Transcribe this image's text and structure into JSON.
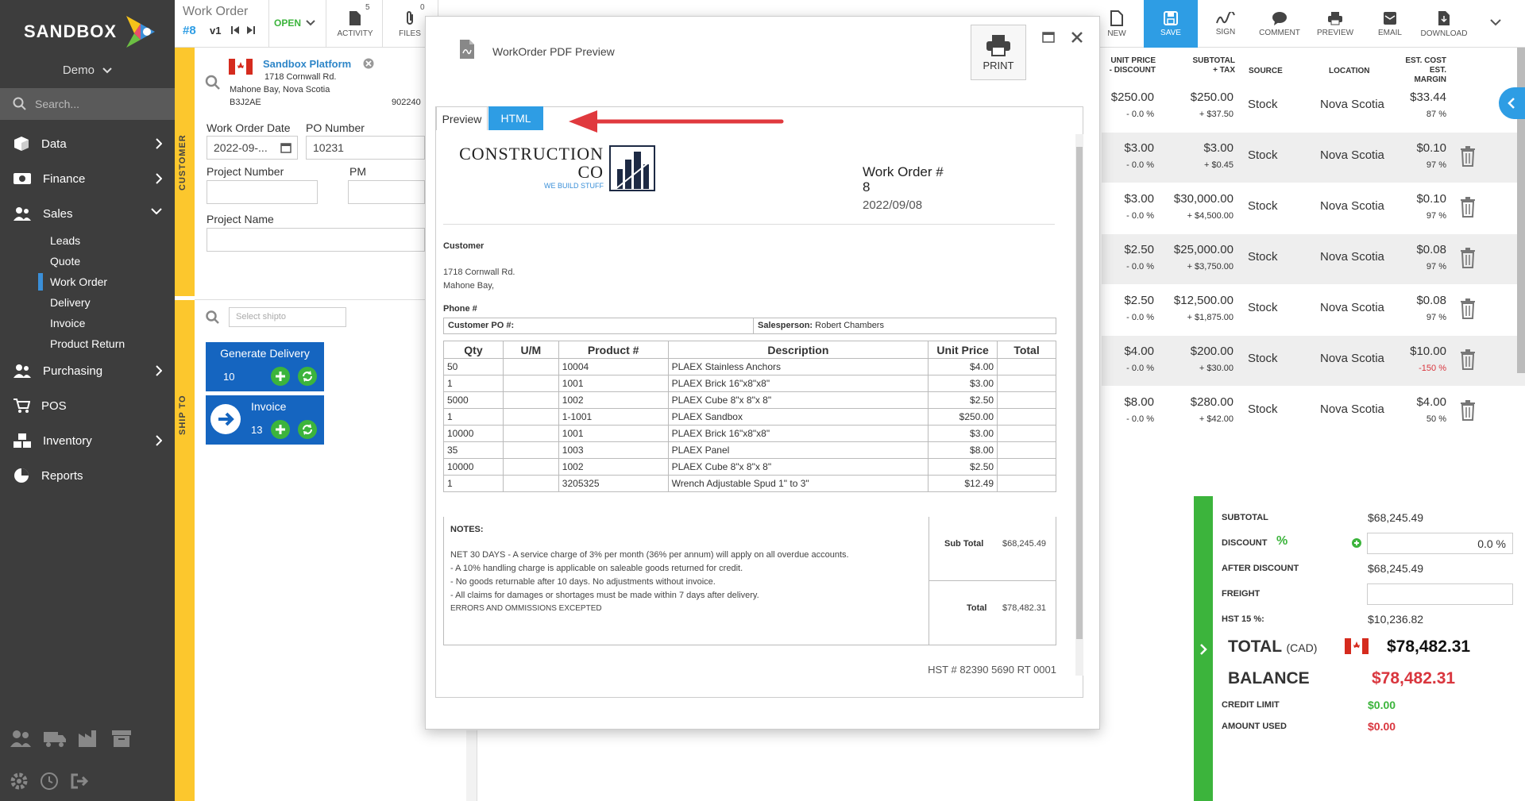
{
  "sidebar": {
    "logo_text": "SANDBOX",
    "company": "Demo",
    "search_placeholder": "Search...",
    "items": [
      {
        "label": "Data"
      },
      {
        "label": "Finance"
      },
      {
        "label": "Sales"
      },
      {
        "label": "Purchasing"
      },
      {
        "label": "POS"
      },
      {
        "label": "Inventory"
      },
      {
        "label": "Reports"
      }
    ],
    "sales_sub": [
      "Leads",
      "Quote",
      "Work Order",
      "Delivery",
      "Invoice",
      "Product Return"
    ],
    "active_sub": "Work Order"
  },
  "header": {
    "doc_type": "Work Order",
    "doc_number": "#8",
    "version": "v1",
    "status": "OPEN",
    "activity_label": "ACTIVITY",
    "activity_count": "5",
    "files_label": "FILES",
    "files_count": "0"
  },
  "toolbar": {
    "new": "NEW",
    "save": "SAVE",
    "sign": "SIGN",
    "comment": "COMMENT",
    "preview": "PREVIEW",
    "email": "EMAIL",
    "download": "DOWNLOAD"
  },
  "customer": {
    "section_label": "CUSTOMER",
    "name": "Sandbox Platform",
    "address1": "1718 Cornwall Rd.",
    "address2": "Mahone Bay, Nova Scotia",
    "postal": "B3J2AE",
    "phone_partial": "902240"
  },
  "form": {
    "wo_date_label": "Work Order Date",
    "wo_date_value": "2022-09-...",
    "po_label": "PO Number",
    "po_value": "10231",
    "project_number_label": "Project Number",
    "pm_label": "PM",
    "project_name_label": "Project Name"
  },
  "shipto": {
    "section_label": "SHIP TO",
    "placeholder": "Select shipto"
  },
  "actions": {
    "generate_delivery": "Generate Delivery",
    "generate_delivery_count": "10",
    "invoice": "Invoice",
    "invoice_count": "13"
  },
  "line_table": {
    "headers": {
      "unit_price": "UNIT PRICE",
      "discount": "- DISCOUNT",
      "subtotal": "SUBTOTAL",
      "tax": "+ TAX",
      "source": "SOURCE",
      "location": "LOCATION",
      "est_cost": "EST. COST",
      "est_margin": "EST. MARGIN"
    },
    "rows": [
      {
        "price": "$250.00",
        "disc": "- 0.0 %",
        "subtotal": "$250.00",
        "tax": "+ $37.50",
        "source": "Stock",
        "location": "Nova Scotia",
        "cost": "$33.44",
        "margin": "87 %"
      },
      {
        "price": "$3.00",
        "disc": "- 0.0 %",
        "subtotal": "$3.00",
        "tax": "+ $0.45",
        "source": "Stock",
        "location": "Nova Scotia",
        "cost": "$0.10",
        "margin": "97 %"
      },
      {
        "price": "$3.00",
        "disc": "- 0.0 %",
        "subtotal": "$30,000.00",
        "tax": "+ $4,500.00",
        "source": "Stock",
        "location": "Nova Scotia",
        "cost": "$0.10",
        "margin": "97 %"
      },
      {
        "price": "$2.50",
        "disc": "- 0.0 %",
        "subtotal": "$25,000.00",
        "tax": "+ $3,750.00",
        "source": "Stock",
        "location": "Nova Scotia",
        "cost": "$0.08",
        "margin": "97 %"
      },
      {
        "price": "$2.50",
        "disc": "- 0.0 %",
        "subtotal": "$12,500.00",
        "tax": "+ $1,875.00",
        "source": "Stock",
        "location": "Nova Scotia",
        "cost": "$0.08",
        "margin": "97 %"
      },
      {
        "price": "$4.00",
        "disc": "- 0.0 %",
        "subtotal": "$200.00",
        "tax": "+ $30.00",
        "source": "Stock",
        "location": "Nova Scotia",
        "cost": "$10.00",
        "margin": "-150 %"
      },
      {
        "price": "$8.00",
        "disc": "- 0.0 %",
        "subtotal": "$280.00",
        "tax": "+ $42.00",
        "source": "Stock",
        "location": "Nova Scotia",
        "cost": "$4.00",
        "margin": "50 %"
      }
    ]
  },
  "totals": {
    "subtotal_label": "SUBTOTAL",
    "subtotal": "$68,245.49",
    "discount_label": "DISCOUNT",
    "discount_value": "0.0 %",
    "after_discount_label": "AFTER DISCOUNT",
    "after_discount": "$68,245.49",
    "freight_label": "FREIGHT",
    "hst_label": "HST 15 %:",
    "hst": "$10,236.82",
    "total_label": "TOTAL",
    "total_currency": "(CAD)",
    "total": "$78,482.31",
    "balance_label": "BALANCE",
    "balance": "$78,482.31",
    "credit_limit_label": "CREDIT LIMIT",
    "credit_limit": "$0.00",
    "amount_used_label": "AMOUNT USED",
    "amount_used": "$0.00"
  },
  "modal": {
    "title": "WorkOrder PDF Preview",
    "print": "PRINT",
    "tabs": [
      "Preview",
      "HTML"
    ],
    "doc": {
      "company_line1": "CONSTRUCTION",
      "company_line2": "CO",
      "tagline": "WE BUILD STUFF",
      "wo_label": "Work Order #",
      "wo_number": "8",
      "wo_date": "2022/09/08",
      "customer_label": "Customer",
      "addr1": "1718 Cornwall Rd.",
      "addr2": "Mahone Bay,",
      "phone_label": "Phone #",
      "cust_po_label": "Customer PO #:",
      "salesperson_label": "Salesperson:",
      "salesperson": "Robert Chambers",
      "table_headers": [
        "Qty",
        "U/M",
        "Product #",
        "Description",
        "Unit Price",
        "Total"
      ],
      "lines": [
        {
          "qty": "50",
          "um": "",
          "product": "10004",
          "desc": "PLAEX Stainless Anchors",
          "price": "$4.00",
          "total": ""
        },
        {
          "qty": "1",
          "um": "",
          "product": "1001",
          "desc": "PLAEX Brick 16\"x8\"x8\"",
          "price": "$3.00",
          "total": ""
        },
        {
          "qty": "5000",
          "um": "",
          "product": "1002",
          "desc": "PLAEX Cube 8\"x 8\"x 8\"",
          "price": "$2.50",
          "total": ""
        },
        {
          "qty": "1",
          "um": "",
          "product": "1-1001",
          "desc": "PLAEX Sandbox",
          "price": "$250.00",
          "total": ""
        },
        {
          "qty": "10000",
          "um": "",
          "product": "1001",
          "desc": "PLAEX Brick 16\"x8\"x8\"",
          "price": "$3.00",
          "total": ""
        },
        {
          "qty": "35",
          "um": "",
          "product": "1003",
          "desc": "PLAEX Panel",
          "price": "$8.00",
          "total": ""
        },
        {
          "qty": "10000",
          "um": "",
          "product": "1002",
          "desc": "PLAEX Cube 8\"x 8\"x 8\"",
          "price": "$2.50",
          "total": ""
        },
        {
          "qty": "1",
          "um": "",
          "product": "3205325",
          "desc": "Wrench Adjustable Spud 1\" to 3\"",
          "price": "$12.49",
          "total": ""
        }
      ],
      "notes_label": "NOTES:",
      "notes": [
        "NET 30 DAYS - A service charge of 3% per month (36% per annum) will apply on all overdue accounts.",
        "- A 10% handling charge is applicable on saleable goods returned for credit.",
        "- No goods returnable after 10 days. No adjustments without invoice.",
        "- All claims for damages or shortages must be made within 7 days after delivery.",
        "ERRORS AND OMMISSIONS EXCEPTED"
      ],
      "subtotal_label": "Sub Total",
      "subtotal": "$68,245.49",
      "total_label": "Total",
      "total": "$78,482.31",
      "hst_number": "HST # 82390 5690 RT 0001"
    }
  },
  "colors": {
    "sidebar": "#3d3d3d",
    "accent": "#2e9de4",
    "yellow": "#fcc72d",
    "green": "#3cb43c",
    "red": "#d9363e",
    "action_blue": "#1565c0"
  }
}
